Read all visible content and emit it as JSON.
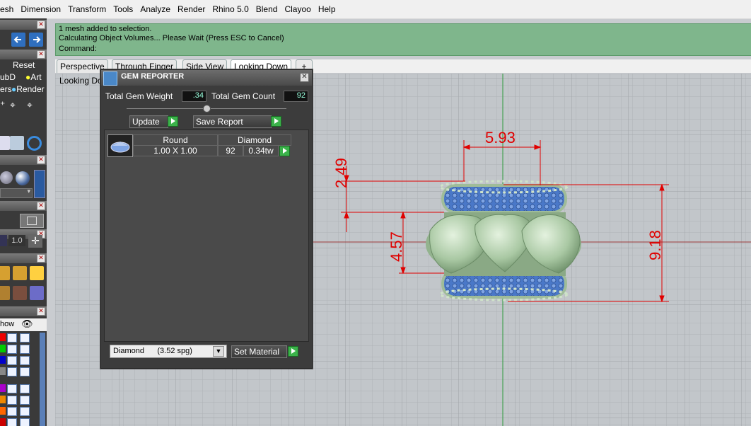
{
  "menubar": {
    "items": [
      "esh",
      "Dimension",
      "Transform",
      "Tools",
      "Analyze",
      "Render",
      "Rhino 5.0",
      "Blend",
      "Clayoo",
      "Help"
    ]
  },
  "left_toolbar": {
    "reset_label": "Reset",
    "subd_label": "ubD",
    "art_label": "Art",
    "layers_label": "ers",
    "render_label": "Render",
    "num_value": "1.0",
    "show_label": "how"
  },
  "command": {
    "lines": [
      "1 mesh added to selection.",
      "Calculating Object Volumes... Please Wait (Press ESC to Cancel)",
      "Command:"
    ]
  },
  "viewport_tabs": [
    "Perspective",
    "Through Finger",
    "Side View",
    "Looking Down"
  ],
  "viewport": {
    "label": "Looking Do",
    "dimensions": {
      "top": "5.93",
      "left_upper": "2.49",
      "left_lower": "4.57",
      "right": "9.18"
    }
  },
  "gem_reporter": {
    "title": "GEM REPORTER",
    "total_weight_label": "Total Gem Weight",
    "total_weight_value": ".34",
    "total_count_label": "Total Gem Count",
    "total_count_value": "92",
    "update_label": "Update",
    "save_report_label": "Save Report",
    "table": {
      "col_shape": "Round",
      "col_material": "Diamond",
      "size": "1.00 X 1.00",
      "count": "92",
      "weight": "0.34tw"
    },
    "material_select": "Diamond      (3.52 spg)",
    "set_material_label": "Set Material"
  },
  "colors": {
    "command_bg": "#7fb68c",
    "dimension": "#e00000",
    "model": "#b4d3ae",
    "gem": "#4a78c8"
  }
}
